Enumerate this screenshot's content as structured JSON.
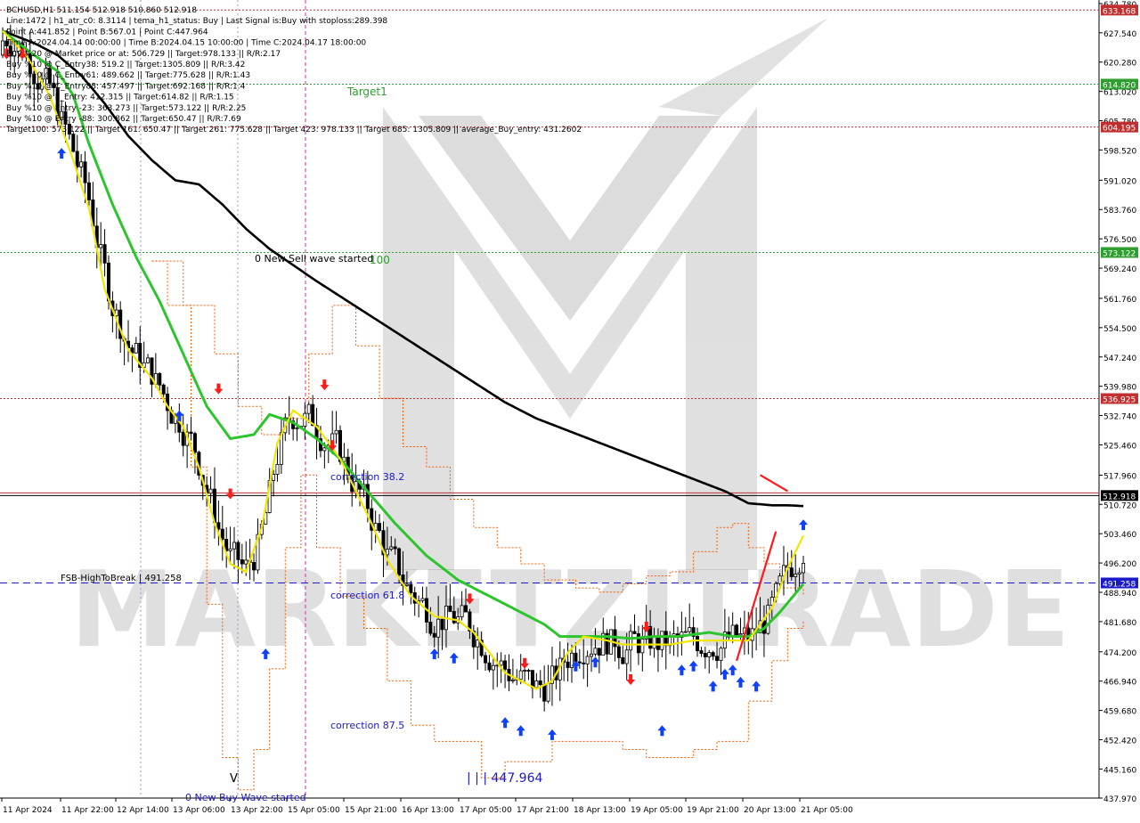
{
  "info_lines": [
    "BCHUSD,H1  511.154 512.918 510.860 512.918",
    "Line:1472 | h1_atr_c0: 8.3114 | tema_h1_status: Buy | Last Signal is:Buy with stoploss:289.398",
    "Point A:441.852 | Point B:567.01 | Point C:447.964",
    "Time A:2024.04.14 00:00:00 | Time B:2024.04.15 10:00:00 | Time C:2024.04.17 18:00:00",
    "Buy %20 @ Market price or at: 506.729 || Target:978.133 || R/R:2.17",
    "Buy %10 @ C_Entry38: 519.2 || Target:1305.809 || R/R:3.42",
    "Buy %10 @ C_Entry61: 489.662 || Target:775.628 || R/R:1.43",
    "Buy %10 @ C_Entry88: 457.497 || Target:692.168 || R/R:1.4",
    "Buy %10 @ E_Entry: 412.315 || Target:614.82 || R/R:1.15",
    "Buy %10 @ Entry -23: 363.273 || Target:573.122 || R/R:2.25",
    "Buy %10 @ Entry -88: 300.862 || Target:650.47 || R/R:7.69",
    "Target100: 573.122 || Target 161: 650.47 || Target 261: 775.628 || Target 423: 978.133 || Target 685: 1305.809 || average_Buy_entry: 431.2602"
  ],
  "annotations": {
    "target1": "Target1",
    "target100": "100",
    "new_sell_wave": "0 New Sell wave started",
    "new_buy_wave": "0 New Buy Wave started",
    "correction_38": "correction 38.2",
    "correction_61": "correction 61.8",
    "correction_87": "correction 87.5",
    "low_label": "| | | 447.964",
    "high_to_break": "FSB-HighToBreak | 491.258",
    "v_mark": "V"
  },
  "watermark": "MARKETZITRADE",
  "colors": {
    "background": "#ffffff",
    "bull_candle": "#000000",
    "bear_candle": "#000000",
    "ema_fast": "#f2e600",
    "ema_mid": "#2dc52d",
    "ema_slow": "#000000",
    "envelope": "#ff5a00",
    "buy_arrow": "#1040ff",
    "sell_arrow": "#ff1a1a",
    "target_line": "#2e9e2e",
    "resistance_line": "#c03030",
    "support_line": "#1a1acc",
    "vline": "#d030a0"
  },
  "chart_data": {
    "type": "candlestick",
    "symbol": "BCHUSD",
    "timeframe": "H1",
    "ylim": [
      437.97,
      634.78
    ],
    "y_ticks": [
      "634.780",
      "627.540",
      "620.280",
      "613.020",
      "605.780",
      "598.520",
      "591.020",
      "583.760",
      "576.500",
      "569.240",
      "561.760",
      "554.500",
      "547.240",
      "539.980",
      "532.740",
      "525.460",
      "517.960",
      "510.720",
      "503.460",
      "496.200",
      "488.940",
      "481.680",
      "474.200",
      "466.940",
      "459.680",
      "452.420",
      "445.160",
      "437.970"
    ],
    "x_ticks": [
      "11 Apr 2024",
      "11 Apr 22:00",
      "12 Apr 14:00",
      "13 Apr 06:00",
      "13 Apr 22:00",
      "15 Apr 05:00",
      "15 Apr 21:00",
      "16 Apr 13:00",
      "17 Apr 05:00",
      "17 Apr 21:00",
      "18 Apr 13:00",
      "19 Apr 05:00",
      "19 Apr 21:00",
      "20 Apr 13:00",
      "21 Apr 05:00"
    ],
    "levels": [
      {
        "value": 633.168,
        "label": "633.168",
        "color": "#c03030",
        "style": "dotted"
      },
      {
        "value": 614.82,
        "label": "614.820",
        "color": "#2e9e2e",
        "style": "dotted"
      },
      {
        "value": 604.195,
        "label": "604.195",
        "color": "#c03030",
        "style": "dotted"
      },
      {
        "value": 573.122,
        "label": "573.122",
        "color": "#2e9e2e",
        "style": "dotted"
      },
      {
        "value": 536.925,
        "label": "536.925",
        "color": "#c03030",
        "style": "dotted"
      },
      {
        "value": 512.918,
        "label": "512.918",
        "color": "#000000",
        "style": "solid"
      },
      {
        "value": 491.258,
        "label": "491.258",
        "color": "#1a1acc",
        "style": "dashed"
      }
    ],
    "ema_slow": [
      [
        0,
        628
      ],
      [
        8,
        625
      ],
      [
        14,
        622
      ],
      [
        20,
        617
      ],
      [
        26,
        610
      ],
      [
        32,
        602
      ],
      [
        38,
        596
      ],
      [
        44,
        591
      ],
      [
        50,
        590
      ],
      [
        56,
        585
      ],
      [
        62,
        579
      ],
      [
        68,
        574
      ],
      [
        74,
        570
      ],
      [
        80,
        566
      ],
      [
        88,
        561
      ],
      [
        96,
        556
      ],
      [
        104,
        551
      ],
      [
        112,
        546
      ],
      [
        120,
        541
      ],
      [
        128,
        536
      ],
      [
        136,
        532
      ],
      [
        144,
        529
      ],
      [
        152,
        526
      ],
      [
        160,
        523
      ],
      [
        168,
        520
      ],
      [
        176,
        517
      ],
      [
        184,
        514
      ],
      [
        190,
        511
      ],
      [
        196,
        510.5
      ],
      [
        200,
        510.5
      ],
      [
        204,
        510.3
      ]
    ],
    "ema_mid": [
      [
        0,
        628
      ],
      [
        8,
        622
      ],
      [
        14,
        618
      ],
      [
        18,
        612
      ],
      [
        22,
        600
      ],
      [
        28,
        585
      ],
      [
        34,
        572
      ],
      [
        40,
        561
      ],
      [
        46,
        548
      ],
      [
        52,
        535
      ],
      [
        58,
        527
      ],
      [
        64,
        528
      ],
      [
        68,
        533
      ],
      [
        74,
        531
      ],
      [
        80,
        527
      ],
      [
        86,
        522
      ],
      [
        92,
        515
      ],
      [
        100,
        506
      ],
      [
        108,
        498
      ],
      [
        116,
        492
      ],
      [
        124,
        488
      ],
      [
        132,
        484
      ],
      [
        138,
        481
      ],
      [
        142,
        478
      ],
      [
        148,
        478
      ],
      [
        154,
        478
      ],
      [
        160,
        477.5
      ],
      [
        166,
        478
      ],
      [
        172,
        478
      ],
      [
        180,
        479
      ],
      [
        186,
        478
      ],
      [
        190,
        478
      ],
      [
        194,
        480
      ],
      [
        198,
        484
      ],
      [
        204,
        491
      ]
    ],
    "ema_fast": [
      [
        0,
        628
      ],
      [
        6,
        622
      ],
      [
        12,
        612
      ],
      [
        18,
        596
      ],
      [
        22,
        584
      ],
      [
        26,
        564
      ],
      [
        32,
        549
      ],
      [
        38,
        542
      ],
      [
        42,
        535
      ],
      [
        46,
        530
      ],
      [
        50,
        520
      ],
      [
        54,
        506
      ],
      [
        58,
        496
      ],
      [
        62,
        494
      ],
      [
        66,
        505
      ],
      [
        70,
        526
      ],
      [
        74,
        534
      ],
      [
        80,
        530
      ],
      [
        86,
        522
      ],
      [
        90,
        514
      ],
      [
        94,
        506
      ],
      [
        98,
        497
      ],
      [
        104,
        488
      ],
      [
        110,
        483
      ],
      [
        116,
        482
      ],
      [
        120,
        479
      ],
      [
        124,
        474
      ],
      [
        128,
        469
      ],
      [
        132,
        467
      ],
      [
        136,
        465
      ],
      [
        140,
        467
      ],
      [
        144,
        474
      ],
      [
        148,
        478
      ],
      [
        154,
        477
      ],
      [
        158,
        476
      ],
      [
        164,
        476
      ],
      [
        170,
        476
      ],
      [
        176,
        477
      ],
      [
        182,
        477
      ],
      [
        186,
        477
      ],
      [
        190,
        477
      ],
      [
        196,
        485
      ],
      [
        200,
        495
      ],
      [
        204,
        503
      ]
    ],
    "envelope_upper": [
      [
        38,
        571
      ],
      [
        42,
        571
      ],
      [
        46,
        560
      ],
      [
        54,
        548
      ],
      [
        60,
        535
      ],
      [
        66,
        528
      ],
      [
        72,
        532
      ],
      [
        78,
        548
      ],
      [
        84,
        560
      ],
      [
        90,
        550
      ],
      [
        96,
        537
      ],
      [
        102,
        525
      ],
      [
        108,
        520
      ],
      [
        114,
        512
      ],
      [
        120,
        505
      ],
      [
        126,
        500
      ],
      [
        132,
        496
      ],
      [
        138,
        492
      ],
      [
        146,
        490
      ],
      [
        152,
        489
      ],
      [
        158,
        491
      ],
      [
        164,
        493
      ],
      [
        170,
        494
      ],
      [
        176,
        499
      ],
      [
        182,
        505
      ],
      [
        186,
        506
      ],
      [
        190,
        500
      ],
      [
        194,
        496
      ],
      [
        198,
        490
      ],
      [
        204,
        488
      ]
    ],
    "envelope_lower": [
      [
        38,
        571
      ],
      [
        42,
        560
      ],
      [
        48,
        520
      ],
      [
        52,
        486
      ],
      [
        56,
        448
      ],
      [
        60,
        440
      ],
      [
        64,
        450
      ],
      [
        68,
        470
      ],
      [
        72,
        500
      ],
      [
        76,
        518
      ],
      [
        80,
        500
      ],
      [
        86,
        488
      ],
      [
        92,
        480
      ],
      [
        98,
        467
      ],
      [
        104,
        456
      ],
      [
        110,
        452
      ],
      [
        116,
        452
      ],
      [
        122,
        443
      ],
      [
        128,
        447
      ],
      [
        134,
        447
      ],
      [
        140,
        452
      ],
      [
        146,
        452
      ],
      [
        152,
        452
      ],
      [
        158,
        450
      ],
      [
        164,
        448
      ],
      [
        170,
        448
      ],
      [
        176,
        450
      ],
      [
        182,
        452
      ],
      [
        186,
        452
      ],
      [
        190,
        462
      ],
      [
        196,
        472
      ],
      [
        200,
        480
      ],
      [
        204,
        482
      ]
    ],
    "buy_arrows": [
      [
        15,
        599
      ],
      [
        45,
        534
      ],
      [
        67,
        475
      ],
      [
        110,
        475
      ],
      [
        115,
        474
      ],
      [
        128,
        458
      ],
      [
        132,
        456
      ],
      [
        140,
        455
      ],
      [
        146,
        472
      ],
      [
        151,
        473
      ],
      [
        168,
        456
      ],
      [
        173,
        471
      ],
      [
        176,
        472
      ],
      [
        181,
        467
      ],
      [
        184,
        470
      ],
      [
        186,
        471
      ],
      [
        188,
        468
      ],
      [
        192,
        467
      ],
      [
        204,
        507
      ]
    ],
    "sell_arrows": [
      [
        1,
        621
      ],
      [
        5,
        621
      ],
      [
        55,
        538
      ],
      [
        58,
        512
      ],
      [
        82,
        539
      ],
      [
        84,
        524
      ],
      [
        119,
        486
      ],
      [
        133,
        470
      ],
      [
        160,
        466
      ],
      [
        164,
        479
      ]
    ],
    "trend_lines": [
      {
        "from": [
          193,
          518
        ],
        "to": [
          200,
          514
        ],
        "color": "#ff1a1a"
      },
      {
        "from": [
          187,
          472
        ],
        "to": [
          197,
          504
        ],
        "color": "#ff1a1a"
      }
    ]
  }
}
